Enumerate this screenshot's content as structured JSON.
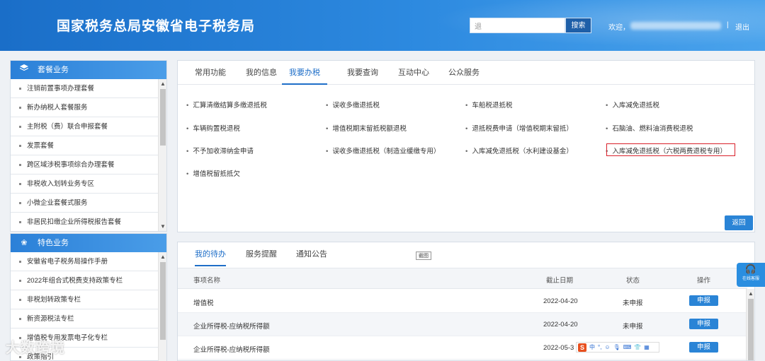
{
  "header": {
    "title": "国家税务总局安徽省电子税务局",
    "search_placeholder": "退",
    "search_button": "搜索",
    "welcome": "欢迎，",
    "separator": "|",
    "logout": "退出"
  },
  "sidebar": {
    "package": {
      "title": "套餐业务",
      "items": [
        "注销前置事项办理套餐",
        "新办纳税人套餐服务",
        "主附税（费）联合申报套餐",
        "发票套餐",
        "跨区域涉税事项综合办理套餐",
        "非税收入划转业务专区",
        "小微企业套餐式服务",
        "非居民扣缴企业所得税报告套餐"
      ]
    },
    "special": {
      "title": "特色业务",
      "items": [
        "安徽省电子税务局操作手册",
        "2022年组合式税费支持政策专栏",
        "非税划转政策专栏",
        "新资源税法专栏",
        "增值税专用发票电子化专栏",
        "政策指引"
      ]
    }
  },
  "main": {
    "tabs": [
      "常用功能",
      "我的信息",
      "我要办税",
      "我要查询",
      "互动中心",
      "公众服务"
    ],
    "active_tab": "我要办税",
    "links": [
      "汇算清缴结算多缴退抵税",
      "误收多缴退抵税",
      "车船税退抵税",
      "入库减免退抵税",
      "车辆购置税退税",
      "增值税期末留抵税额退税",
      "退抵税费申请（增值税期末留抵）",
      "石脑油、燃料油消费税退税",
      "不予加收滞纳金申请",
      "误收多缴退抵税（制造业缓缴专用）",
      "入库减免退抵税（水利建设基金）",
      "入库减免退抵税（六税两费退税专用）",
      "增值税留抵抵欠"
    ],
    "return_button": "返回"
  },
  "todo": {
    "tabs": [
      "我的待办",
      "服务提醒",
      "通知公告"
    ],
    "active_tab": "我的待办",
    "screenshot_tag": "截图",
    "columns": [
      "事项名称",
      "截止日期",
      "状态",
      "操作"
    ],
    "rows": [
      {
        "name": "增值税",
        "deadline": "2022-04-20",
        "status": "未申报",
        "action": "申报"
      },
      {
        "name": "企业所得税-应纳税所得额",
        "deadline": "2022-04-20",
        "status": "未申报",
        "action": "申报"
      },
      {
        "name": "企业所得税-应纳税所得额",
        "deadline": "2022-05-3",
        "status": "",
        "action": "申报"
      }
    ]
  },
  "ime": {
    "s": "S",
    "cn": "中"
  },
  "online_service": {
    "icon": "headset-icon",
    "label": "在线客服"
  },
  "watermark": "大数跨境",
  "colors": {
    "header": "#1a6ec8",
    "accent": "#2a84d6",
    "highlight_border": "#d9202a"
  }
}
